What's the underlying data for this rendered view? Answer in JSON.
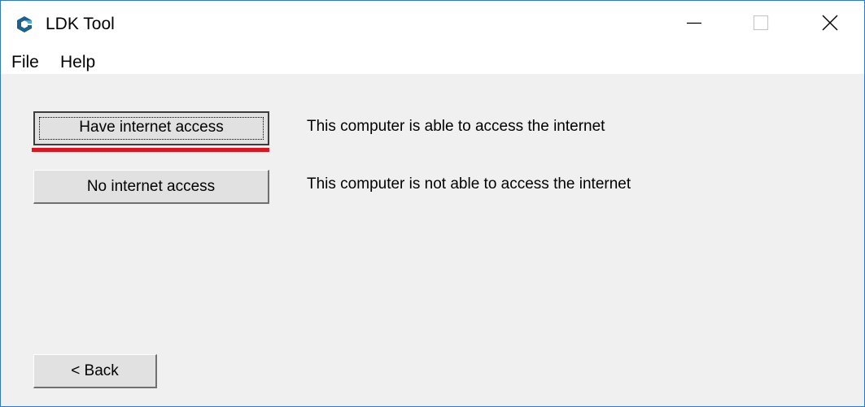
{
  "window": {
    "title": "LDK Tool",
    "app_icon": "ldk-logo-icon",
    "controls": {
      "minimize_icon": "minimize-icon",
      "maximize_icon": "maximize-icon",
      "close_icon": "close-icon"
    }
  },
  "menubar": {
    "items": [
      {
        "label": "File"
      },
      {
        "label": "Help"
      }
    ]
  },
  "options": [
    {
      "button_label": "Have internet access",
      "description": "This computer is able to access the internet",
      "focused": true,
      "highlight_color": "#e0141e"
    },
    {
      "button_label": "No internet access",
      "description": "This computer is not able to access the internet",
      "focused": false
    }
  ],
  "footer": {
    "back_label": "< Back"
  },
  "colors": {
    "window_border": "#2b79d6",
    "client_background": "#f0f0f0",
    "button_face": "#e1e1e1",
    "logo_blue": "#1f5f8b",
    "logo_teal": "#4ab0c8"
  }
}
